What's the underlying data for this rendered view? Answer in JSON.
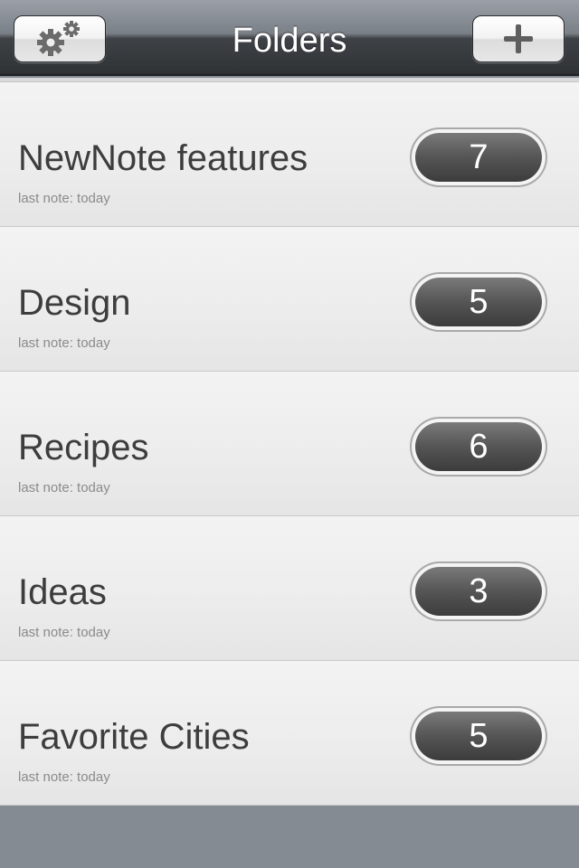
{
  "navbar": {
    "title": "Folders",
    "left_button_icon": "gears-icon",
    "right_button_icon": "plus-icon"
  },
  "folders": [
    {
      "name": "NewNote features",
      "subtitle": "last note: today",
      "count": "7"
    },
    {
      "name": "Design",
      "subtitle": "last note: today",
      "count": "5"
    },
    {
      "name": "Recipes",
      "subtitle": "last note: today",
      "count": "6"
    },
    {
      "name": "Ideas",
      "subtitle": "last note: today",
      "count": "3"
    },
    {
      "name": "Favorite Cities",
      "subtitle": "last note: today",
      "count": "5"
    }
  ],
  "colors": {
    "background": "#858b93",
    "navbar_dark": "#2f3235",
    "row_bg": "#ececec",
    "badge": "#555555"
  }
}
